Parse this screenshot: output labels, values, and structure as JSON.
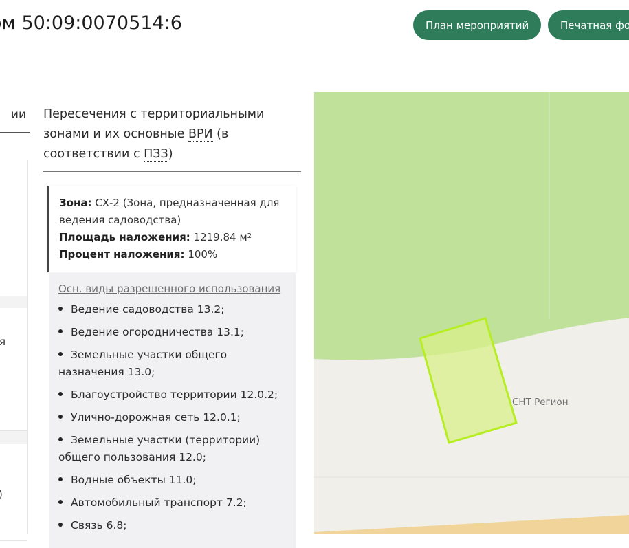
{
  "header": {
    "title": "ом 50:09:0070514:6",
    "buttons": {
      "plan": "План мероприятий",
      "print": "Печатная фо"
    }
  },
  "left_panel": {
    "tab_label_fragment": "ии",
    "strip_letters": [
      "я",
      ")"
    ]
  },
  "intersections": {
    "heading_before": "Пересечения с территориальными зонами и их основные ",
    "heading_abbr_vri": "ВРИ",
    "heading_mid": " (в соответствии с ",
    "heading_abbr_pzz": "ПЗЗ",
    "heading_after": ")"
  },
  "zone": {
    "zone_label": "Зона:",
    "zone_value": " СХ-2 (Зона, предназначенная для ведения садоводства)",
    "area_label": "Площадь наложения:",
    "area_value": " 1219.84 м",
    "area_unit_sup": "2",
    "percent_label": "Процент наложения:",
    "percent_value": " 100%"
  },
  "vri": {
    "title": "Осн. виды разрешенного использования",
    "items": [
      "Ведение садоводства 13.2;",
      "Ведение огородничества 13.1;",
      "Земельные участки общего назначения 13.0;",
      "Благоустройство территории 12.0.2;",
      "Улично-дорожная сеть 12.0.1;",
      "Земельные участки (территории) общего пользования 12.0;",
      "Водные объекты 11.0;",
      "Автомобильный транспорт 7.2;",
      "Связь 6.8;"
    ]
  },
  "map": {
    "place_label": "СНТ Регион",
    "colors": {
      "zone_fill": "#bfe19a",
      "parcel_fill": "#d9f08a",
      "parcel_stroke": "#b6ee22",
      "ground": "#f0efe9"
    }
  },
  "colors": {
    "accent": "#2f7c5b"
  }
}
